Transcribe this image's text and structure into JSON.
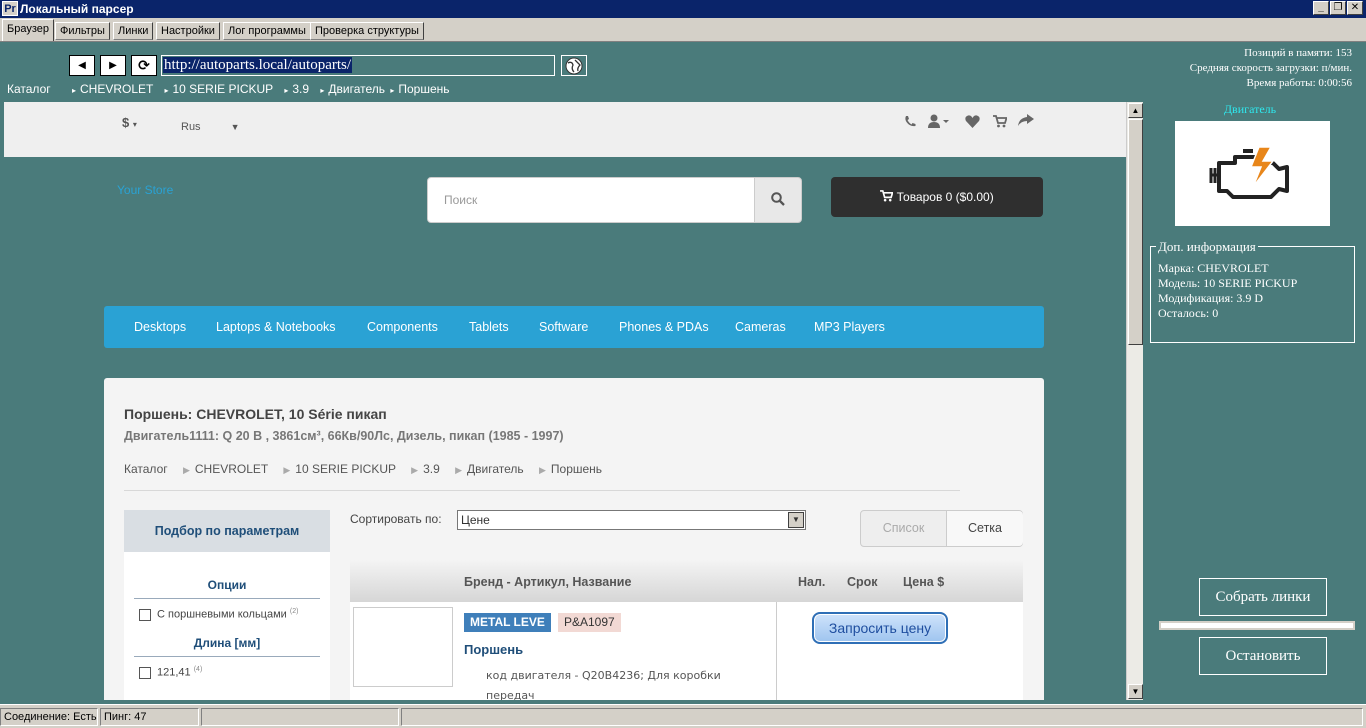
{
  "window": {
    "icon_text": "Pr",
    "title": "Локальный парсер",
    "minimize": "_",
    "restore": "❐",
    "close": "✕"
  },
  "tabs": [
    "Браузер",
    "Фильтры",
    "Линки",
    "Настройки",
    "Лог программы",
    "Проверка структуры"
  ],
  "nav": {
    "back": "◀",
    "forward": "▶",
    "refresh": "⟳",
    "url": "http://autoparts.local/autoparts/",
    "go": "🌐"
  },
  "breadcrumb": [
    "Каталог",
    "CHEVROLET",
    "10 SERIE PICKUP",
    "3.9",
    "Двигатель",
    "Поршень"
  ],
  "stats": {
    "memory": "Позиций в памяти: 153",
    "speed": "Средняя скорость загрузки:  п/мин.",
    "uptime": "Время работы: 0:00:56"
  },
  "store": {
    "currency": "$",
    "language": "Rus",
    "logo": "Your Store",
    "search_placeholder": "Поиск",
    "cart_label": "Товаров 0 ($0.00)",
    "menu": [
      "Desktops",
      "Laptops & Notebooks",
      "Components",
      "Tablets",
      "Software",
      "Phones & PDAs",
      "Cameras",
      "MP3 Players"
    ],
    "product_title": "Поршень: CHEVROLET, 10 Série пикап",
    "product_subtitle": "Двигатель1111: Q 20 B , 3861см³, 66Кв/90Лс, Дизель, пикап (1985 - 1997)",
    "crumbs": [
      "Каталог",
      "CHEVROLET",
      "10 SERIE PICKUP",
      "3.9",
      "Двигатель",
      "Поршень"
    ],
    "filter_title": "Подбор по параметрам",
    "filter_options_title": "Опции",
    "filter_option_1": "С поршневыми кольцами",
    "filter_option_1_count": "(2)",
    "filter_length_title": "Длина [мм]",
    "filter_length_1": "121,41",
    "filter_length_1_count": "(4)",
    "sort_label": "Сортировать по:",
    "sort_value": "Цене",
    "view_list": "Список",
    "view_grid": "Сетка",
    "col_brand": "Бренд - Артикул, Название",
    "col_stock": "Нал.",
    "col_term": "Срок",
    "col_price": "Цена $",
    "item_brand": "METAL LEVE",
    "item_sku": "P&A1097",
    "item_name": "Поршень",
    "item_desc": "код двигателя - Q20B4236; Для коробки передач",
    "item_button": "Запросить цену"
  },
  "right_panel": {
    "title": "Двигатель",
    "info_legend": "Доп. информация",
    "brand": "Марка: CHEVROLET",
    "model": "Модель: 10 SERIE PICKUP",
    "modification": "Модификация: 3.9 D",
    "remaining": "Осталось: 0",
    "collect_button": "Собрать линки",
    "stop_button": "Остановить"
  },
  "statusbar": {
    "connection": "Соединение: Есть",
    "ping": "Пинг: 47"
  }
}
